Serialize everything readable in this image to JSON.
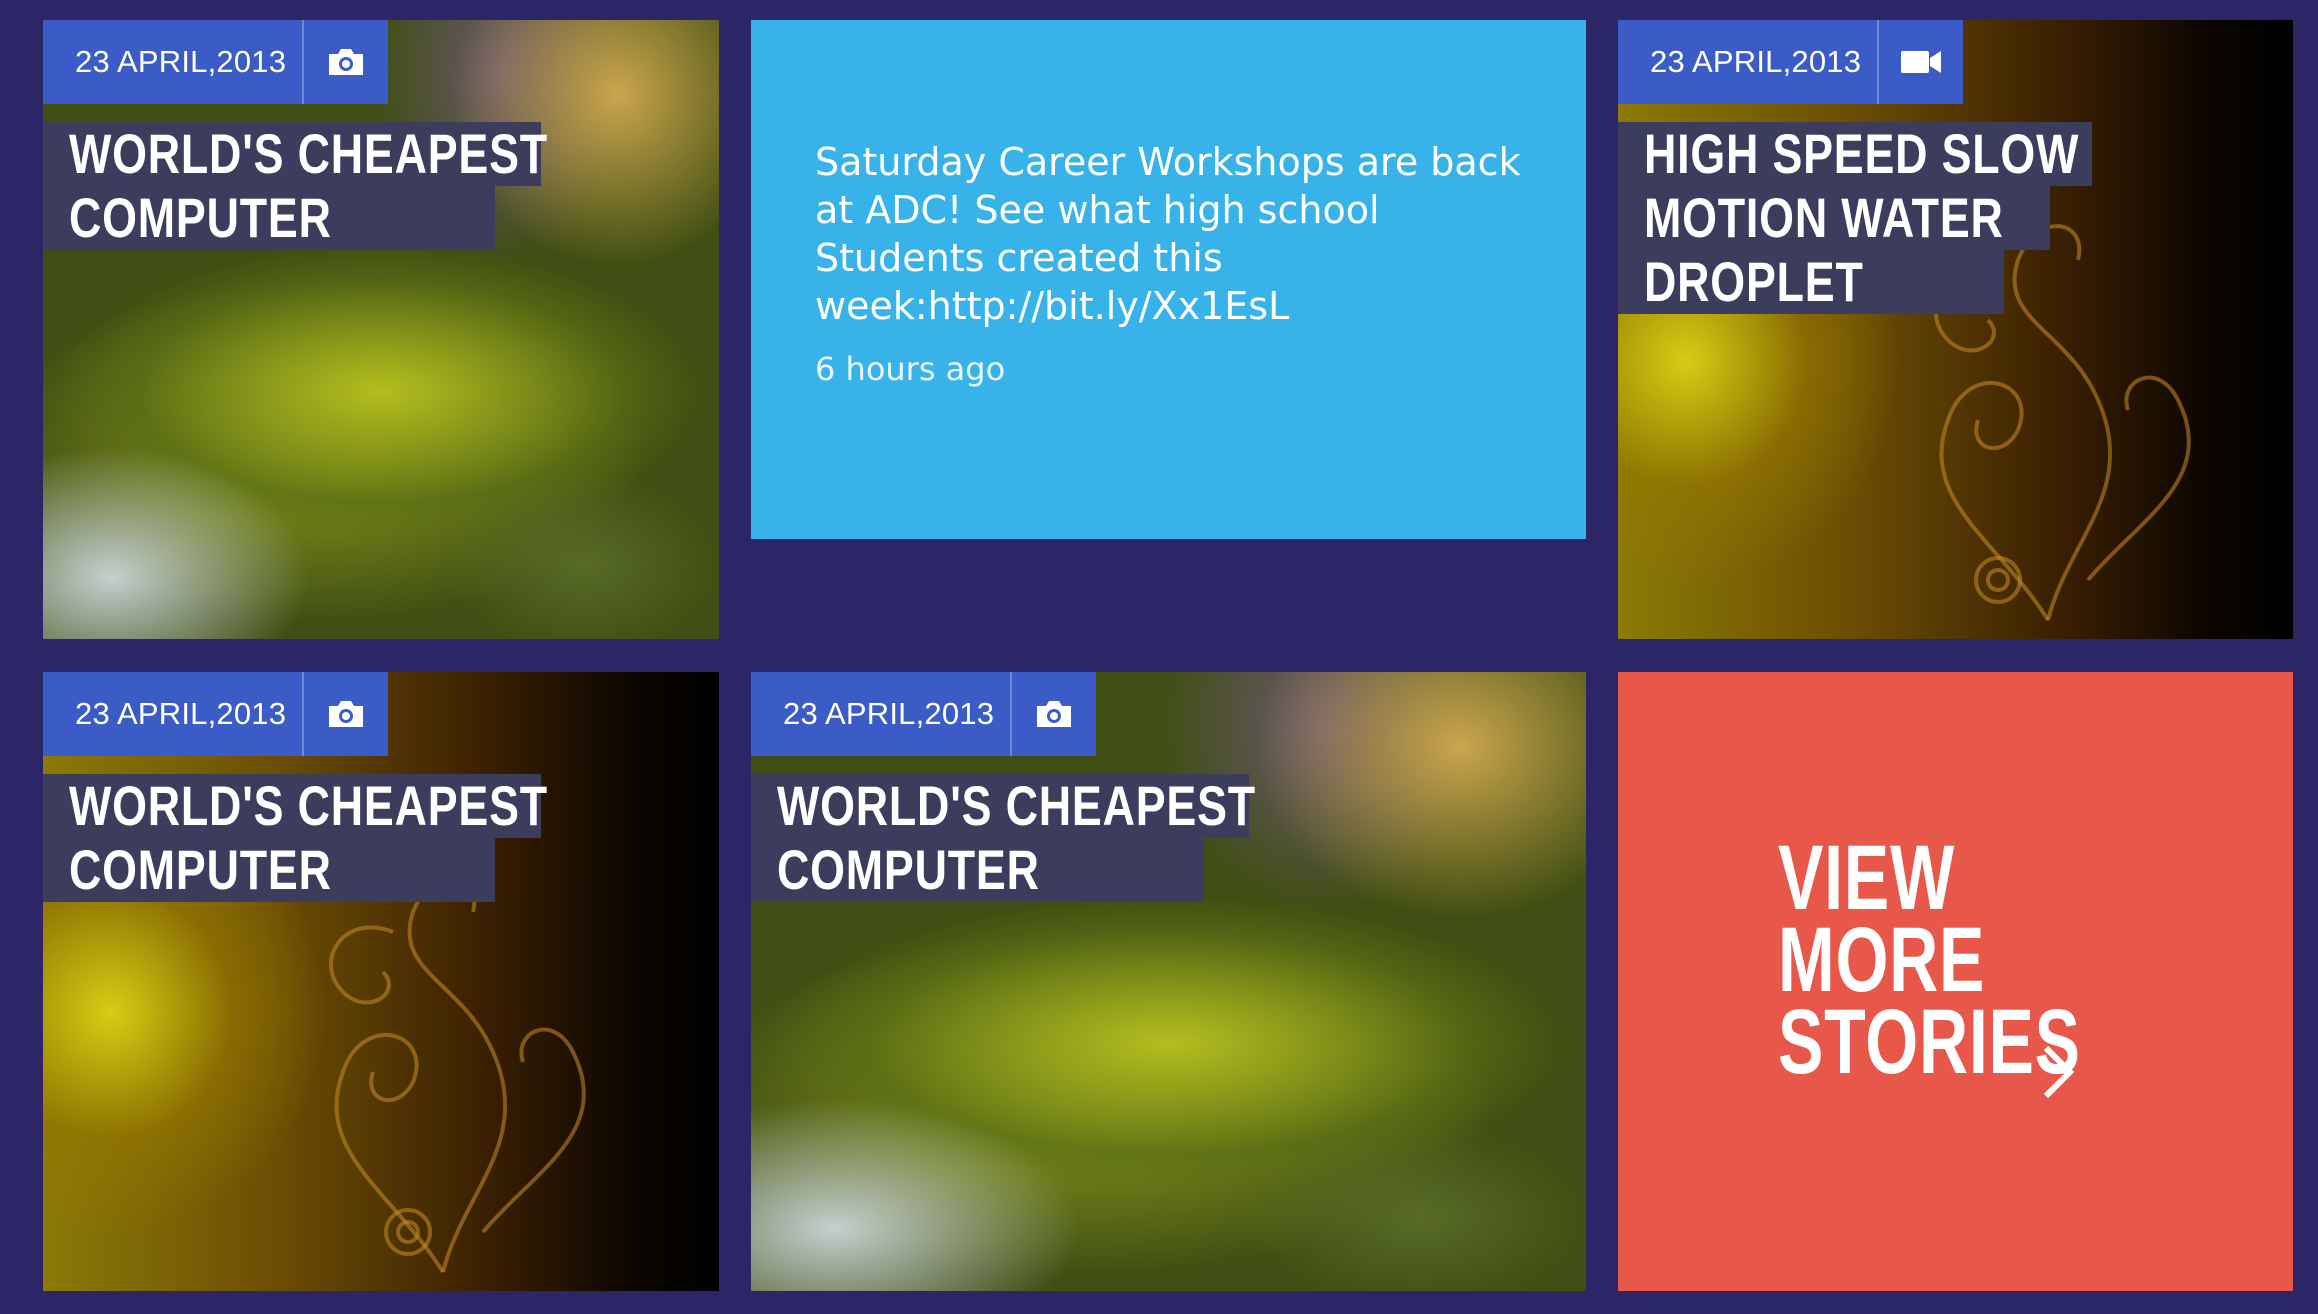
{
  "tiles": [
    {
      "date": "23 APRIL,2013",
      "icon": "camera-icon",
      "title": [
        "WORLD'S CHEAPEST",
        "COMPUTER"
      ]
    },
    {
      "date": "23 APRIL,2013",
      "icon": "video-camera-icon",
      "title": [
        "HIGH SPEED SLOW",
        "MOTION WATER",
        "DROPLET"
      ]
    },
    {
      "date": "23 APRIL,2013",
      "icon": "camera-icon",
      "title": [
        "WORLD'S CHEAPEST",
        "COMPUTER"
      ]
    },
    {
      "date": "23 APRIL,2013",
      "icon": "camera-icon",
      "title": [
        "WORLD'S CHEAPEST",
        "COMPUTER"
      ]
    }
  ],
  "tweet": {
    "text": "Saturday Career Workshops are back at ADC! See what high school Students created this week:http://bit.ly/Xx1EsL",
    "time": "6 hours ago"
  },
  "more": {
    "lines": [
      "VIEW",
      "MORE",
      "STORIES"
    ],
    "icon": "chevron-right-icon"
  },
  "colors": {
    "background": "#2c2566",
    "date_bar": "#3b5cc6",
    "title_bar": "#3c3d5d",
    "tweet_bg": "#37b3ea",
    "more_bg": "#e8584a"
  }
}
